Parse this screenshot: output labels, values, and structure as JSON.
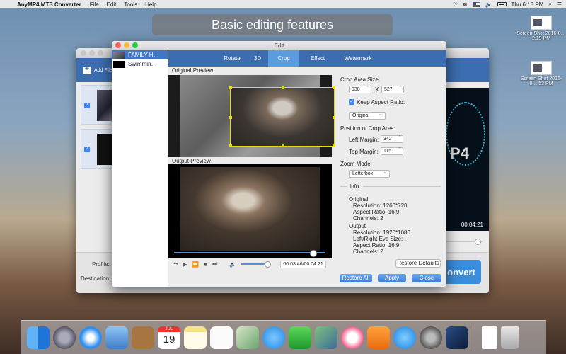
{
  "menubar": {
    "app_name": "AnyMP4 MTS Converter",
    "menus": [
      "File",
      "Edit",
      "Tools",
      "Help"
    ],
    "clock": "Thu 6:18 PM"
  },
  "banner": {
    "text": "Basic editing features"
  },
  "desktop_icons": [
    {
      "label": "Screen Shot 2016-0…2.19 PM"
    },
    {
      "label": "Screen Shot 2016-0….53 PM"
    }
  ],
  "main_window": {
    "add_file_label": "Add File",
    "preview_time": "00:04:21",
    "profile_label": "Profile:",
    "destination_label": "Destination:",
    "convert_label": "onvert"
  },
  "edit_window": {
    "title": "Edit",
    "files": [
      {
        "name": "FAMILY-H…",
        "selected": true
      },
      {
        "name": "Swimmin…",
        "selected": false
      }
    ],
    "tabs": [
      {
        "label": "Rotate",
        "active": false
      },
      {
        "label": "3D",
        "active": false
      },
      {
        "label": "Crop",
        "active": true
      },
      {
        "label": "Effect",
        "active": false
      },
      {
        "label": "Watermark",
        "active": false
      }
    ],
    "original_preview_label": "Original Preview",
    "output_preview_label": "Output Preview",
    "player": {
      "time": "00:03:46/00:04:21",
      "progress": 0.9,
      "volume": 0.85
    },
    "crop": {
      "area_size_label": "Crop Area Size:",
      "width": "938",
      "x_label": "X",
      "height": "527",
      "keep_aspect_label": "Keep Aspect Ratio:",
      "aspect_value": "Original",
      "position_label": "Position of Crop Area:",
      "left_margin_label": "Left Margin:",
      "left_margin": "342",
      "top_margin_label": "Top Margin:",
      "top_margin": "115",
      "zoom_mode_label": "Zoom Mode:",
      "zoom_mode": "Letterbox"
    },
    "info": {
      "title": "Info",
      "original_title": "Original",
      "original": [
        "Resolution: 1260*720",
        "Aspect Ratio: 16:9",
        "Channels: 2"
      ],
      "output_title": "Output",
      "output": [
        "Resolution: 1920*1080",
        "Left/Right Eye Size: -",
        "Aspect Ratio: 16:9",
        "Channels: 2"
      ]
    },
    "buttons": {
      "restore_defaults": "Restore Defaults",
      "restore_all": "Restore All",
      "apply": "Apply",
      "close": "Close"
    }
  },
  "dock_icons": [
    "finder-icon",
    "launchpad-icon",
    "safari-icon",
    "mail-icon",
    "notes-book-icon",
    "calendar-icon",
    "notes-icon",
    "reminders-icon",
    "preview-icon",
    "messages-icon",
    "facetime-icon",
    "photos-icon",
    "itunes-icon",
    "ibooks-icon",
    "app-store-icon",
    "system-preferences-icon",
    "mts-converter-icon",
    "file-icon",
    "trash-icon"
  ],
  "calendar_day": "19",
  "calendar_month": "JUL",
  "colors": {
    "accent": "#3c6db0",
    "active_tab": "#5b9be0",
    "crop_border": "#e6e000"
  }
}
